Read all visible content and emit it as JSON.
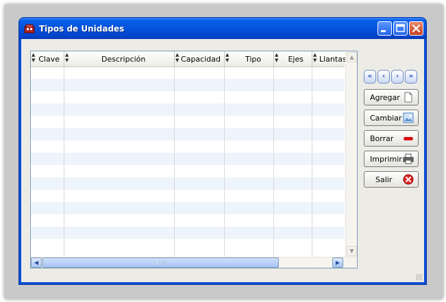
{
  "window": {
    "title": "Tipos de Unidades",
    "title_color": "#ffffff",
    "accent": "#0a50d4"
  },
  "table": {
    "columns": [
      {
        "label": "Clave",
        "align": "right"
      },
      {
        "label": "Descripción",
        "align": "center"
      },
      {
        "label": "Capacidad",
        "align": "right"
      },
      {
        "label": "Tipo",
        "align": "center"
      },
      {
        "label": "Ejes",
        "align": "right"
      },
      {
        "label": "Llantas",
        "align": "right"
      }
    ],
    "rows": []
  },
  "navigation": {
    "first": "first-record",
    "prev": "previous-record",
    "next": "next-record",
    "last": "last-record"
  },
  "actions": {
    "add": "Agregar",
    "edit": "Cambiar",
    "delete": "Borrar",
    "print": "Imprimir",
    "exit": "Salir"
  }
}
